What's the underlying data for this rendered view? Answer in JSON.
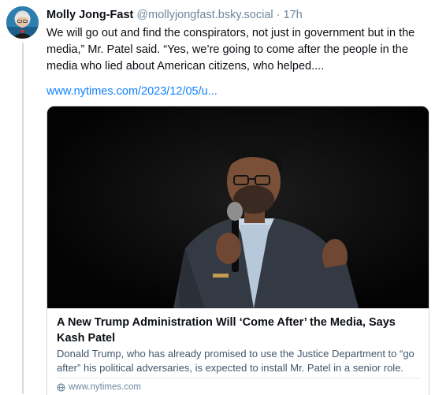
{
  "post": {
    "author_name": "Molly Jong-Fast",
    "author_handle": "@mollyjongfast.bsky.social",
    "separator": "·",
    "time": "17h",
    "text": "We will go out and find the conspirators, not just in government but in the media,” Mr. Patel said. “Yes, we’re going to come after the people in the media who lied about American citizens, who helped....",
    "link_text": "www.nytimes.com/2023/12/05/u..."
  },
  "link_card": {
    "title": "A New Trump Administration Will ‘Come After’ the Media, Says Kash Patel",
    "description": "Donald Trump, who has already promised to use the Justice Department to “go after” his political adversaries, is expected to install Mr. Patel in a senior role.",
    "domain": "www.nytimes.com",
    "domain_icon": "globe-icon"
  },
  "colors": {
    "link": "#1083fe",
    "muted": "#6f869f",
    "border": "#d4dbe2"
  }
}
